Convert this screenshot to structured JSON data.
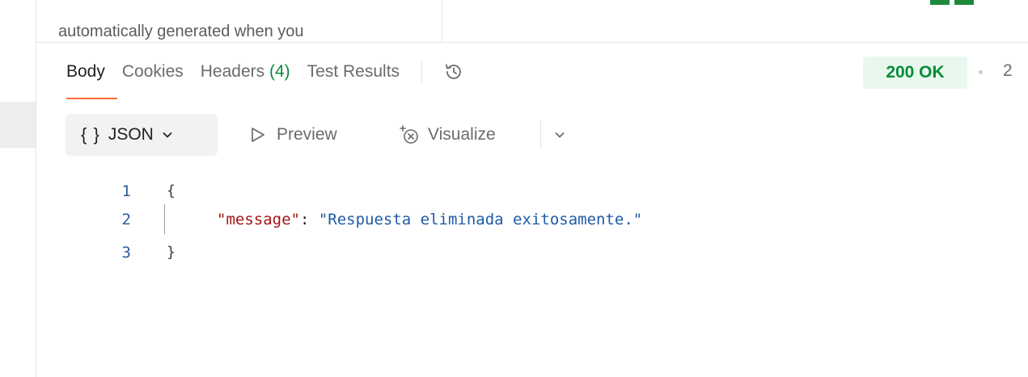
{
  "description_fragment": "automatically generated when you",
  "tabs": [
    {
      "label": "Body",
      "count": ""
    },
    {
      "label": "Cookies",
      "count": ""
    },
    {
      "label": "Headers",
      "count": "(4)"
    },
    {
      "label": "Test Results",
      "count": ""
    }
  ],
  "status": {
    "code_text": "200 OK",
    "time_fragment": "2"
  },
  "toolbar": {
    "format_braces": "{ }",
    "format_label": "JSON",
    "preview_label": "Preview",
    "visualize_label": "Visualize"
  },
  "editor": {
    "line_numbers": [
      "1",
      "2",
      "3"
    ],
    "open_brace": "{",
    "key": "\"message\"",
    "colon": ": ",
    "value": "\"Respuesta eliminada exitosamente.\"",
    "close_brace": "}"
  },
  "icons": {
    "history": "history-icon",
    "play": "play-icon",
    "visualize": "visualize-sparkle-icon",
    "chevron": "chevron-down-icon",
    "logo": "logo-icon"
  },
  "colors": {
    "accent_orange": "#ff6c37",
    "success_green": "#0a8a3a",
    "success_bg": "#e8f8ee",
    "json_key": "#a31515",
    "json_string": "#1f5aa6"
  }
}
